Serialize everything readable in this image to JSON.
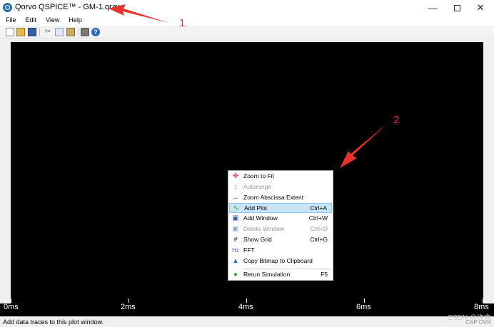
{
  "window": {
    "title": "Qorvo QSPICE™ - GM-1.qraw",
    "min_glyph": "—",
    "close_glyph": "✕"
  },
  "menubar": [
    "File",
    "Edit",
    "View",
    "Help"
  ],
  "toolbar": {
    "icons": [
      "new-file-icon",
      "open-folder-icon",
      "save-icon",
      "cut-icon",
      "copy-icon",
      "paste-icon",
      "print-icon",
      "help-icon"
    ],
    "help_glyph": "?",
    "cut_glyph": "✂"
  },
  "plot": {
    "background": "#000000",
    "x_ticks": [
      "0ms",
      "2ms",
      "4ms",
      "6ms",
      "8ms"
    ]
  },
  "context_menu": {
    "items": [
      {
        "label": "Zoom to Fit",
        "shortcut": "",
        "icon": "✥",
        "icon_color": "#d84040",
        "disabled": false
      },
      {
        "label": "Autorange",
        "shortcut": "",
        "icon": "↕",
        "icon_color": "#e08a8a",
        "disabled": true
      },
      {
        "label": "Zoom Abscissa Extent",
        "shortcut": "",
        "icon": "↔",
        "icon_color": "#d84040",
        "disabled": false
      },
      {
        "label": "Add Plot",
        "shortcut": "Ctrl+A",
        "icon": "∿",
        "icon_color": "#2e9e3a",
        "disabled": false
      },
      {
        "label": "Add Window",
        "shortcut": "Ctrl+W",
        "icon": "▣",
        "icon_color": "#3a5da8",
        "disabled": false
      },
      {
        "label": "Delete Window",
        "shortcut": "Ctrl+D",
        "icon": "▣",
        "icon_color": "#9aaccc",
        "disabled": true
      },
      {
        "label": "Show Grid",
        "shortcut": "Ctrl+G",
        "icon": "#",
        "icon_color": "#444444",
        "disabled": false
      },
      {
        "label": "FFT",
        "shortcut": "",
        "icon": "Hz",
        "icon_color": "#3a5da8",
        "disabled": false
      },
      {
        "label": "Copy Bitmap to Clipboard",
        "shortcut": "",
        "icon": "▲",
        "icon_color": "#3a6fb8",
        "disabled": false
      },
      {
        "label": "Rerun Simulation",
        "shortcut": "F5",
        "icon": "●",
        "icon_color": "#2fae3e",
        "disabled": false
      }
    ]
  },
  "statusbar": {
    "text": "Add data traces to this plot window.",
    "indicators": "CAP OVR"
  },
  "watermark": "CSDN @许言",
  "annotations": {
    "color": "#e8322c",
    "labels": [
      "1",
      "2"
    ]
  }
}
